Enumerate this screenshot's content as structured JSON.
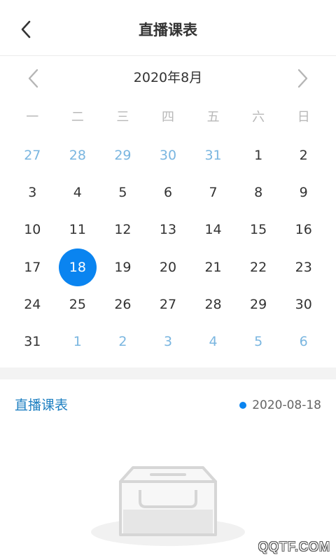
{
  "header": {
    "title": "直播课表",
    "back_icon": "chevron-left-icon"
  },
  "calendar": {
    "month_label": "2020年8月",
    "prev_icon": "chevron-left-icon",
    "next_icon": "chevron-right-icon",
    "weekdays": [
      "一",
      "二",
      "三",
      "四",
      "五",
      "六",
      "日"
    ],
    "days": [
      {
        "d": "27",
        "other": true
      },
      {
        "d": "28",
        "other": true
      },
      {
        "d": "29",
        "other": true
      },
      {
        "d": "30",
        "other": true
      },
      {
        "d": "31",
        "other": true
      },
      {
        "d": "1"
      },
      {
        "d": "2"
      },
      {
        "d": "3"
      },
      {
        "d": "4"
      },
      {
        "d": "5"
      },
      {
        "d": "6"
      },
      {
        "d": "7"
      },
      {
        "d": "8"
      },
      {
        "d": "9"
      },
      {
        "d": "10"
      },
      {
        "d": "11"
      },
      {
        "d": "12"
      },
      {
        "d": "13"
      },
      {
        "d": "14"
      },
      {
        "d": "15"
      },
      {
        "d": "16"
      },
      {
        "d": "17"
      },
      {
        "d": "18",
        "selected": true
      },
      {
        "d": "19"
      },
      {
        "d": "20"
      },
      {
        "d": "21"
      },
      {
        "d": "22"
      },
      {
        "d": "23"
      },
      {
        "d": "24"
      },
      {
        "d": "25"
      },
      {
        "d": "26"
      },
      {
        "d": "27"
      },
      {
        "d": "28"
      },
      {
        "d": "29"
      },
      {
        "d": "30"
      },
      {
        "d": "31"
      },
      {
        "d": "1",
        "other": true
      },
      {
        "d": "2",
        "other": true
      },
      {
        "d": "3",
        "other": true
      },
      {
        "d": "4",
        "other": true
      },
      {
        "d": "5",
        "other": true
      },
      {
        "d": "6",
        "other": true
      }
    ]
  },
  "schedule": {
    "title": "直播课表",
    "selected_date": "2020-08-18",
    "empty_icon": "empty-inbox-icon"
  },
  "colors": {
    "accent": "#0a84f0",
    "section_title": "#1d7fc1",
    "other_month": "#7ab6e0"
  },
  "watermark": "QQTF.COM"
}
